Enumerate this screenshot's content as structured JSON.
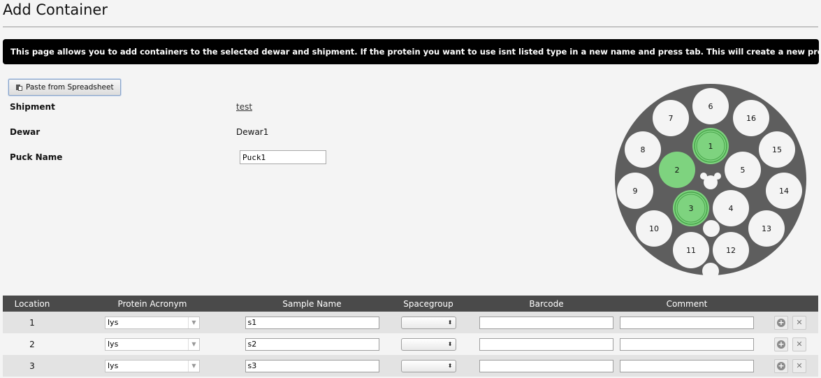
{
  "page": {
    "title": "Add Container",
    "banner": "This page allows you to add containers to the selected dewar and shipment. If the protein you want to use isnt listed type in a new name and press tab. This will create a new protein"
  },
  "toolbar": {
    "paste_label": "Paste from Spreadsheet"
  },
  "details": {
    "shipment_label": "Shipment",
    "shipment_value": "test",
    "dewar_label": "Dewar",
    "dewar_value": "Dewar1",
    "puck_label": "Puck Name",
    "puck_value": "Puck1"
  },
  "puck": {
    "positions": [
      "1",
      "2",
      "3",
      "4",
      "5",
      "6",
      "7",
      "8",
      "9",
      "10",
      "11",
      "12",
      "13",
      "14",
      "15",
      "16"
    ],
    "filled": [
      "1",
      "2",
      "3"
    ],
    "colors": {
      "body": "#5e5e5e",
      "slot": "#f4f4f4",
      "filled": "#7ed37f",
      "filled_ring": "#4aa64c"
    }
  },
  "table": {
    "headers": [
      "Location",
      "Protein Acronym",
      "Sample Name",
      "Spacegroup",
      "Barcode",
      "Comment"
    ],
    "rows": [
      {
        "location": "1",
        "protein": "lys",
        "sample": "s1",
        "spacegroup": "",
        "barcode": "",
        "comment": ""
      },
      {
        "location": "2",
        "protein": "lys",
        "sample": "s2",
        "spacegroup": "",
        "barcode": "",
        "comment": ""
      },
      {
        "location": "3",
        "protein": "lys",
        "sample": "s3",
        "spacegroup": "",
        "barcode": "",
        "comment": ""
      }
    ],
    "icons": {
      "add": "plus-circle-icon",
      "remove": "close-icon"
    }
  }
}
